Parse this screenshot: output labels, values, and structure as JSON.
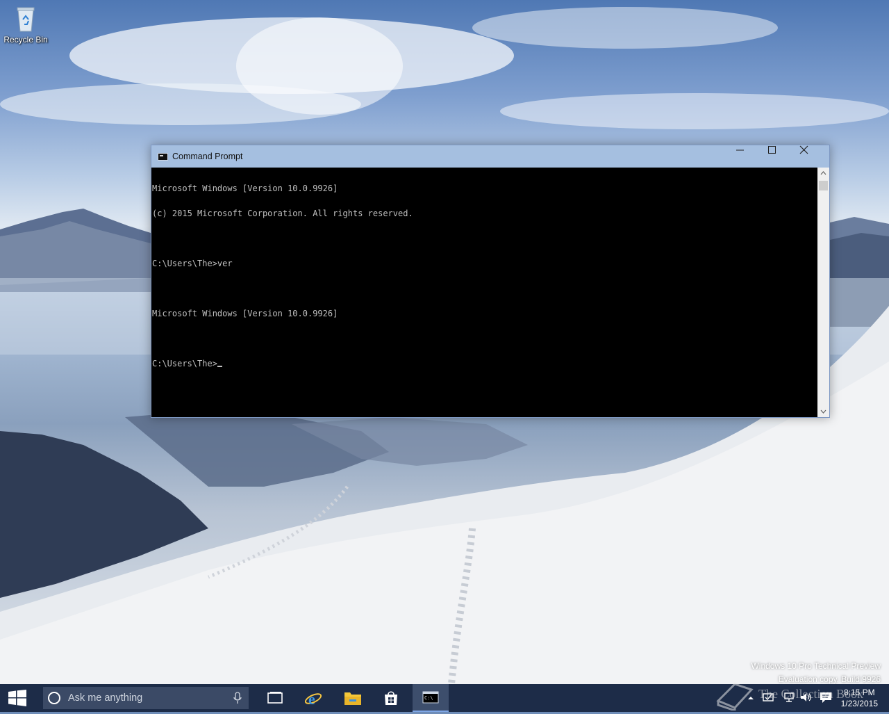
{
  "desktop": {
    "icons": [
      {
        "label": "Recycle Bin",
        "icon": "recycle-bin-icon"
      }
    ]
  },
  "window": {
    "title": "Command Prompt",
    "icon": "command-prompt-icon",
    "controls": {
      "minimize": "minimize-icon",
      "maximize": "maximize-icon",
      "close": "close-icon"
    },
    "console_lines": [
      "Microsoft Windows [Version 10.0.9926]",
      "(c) 2015 Microsoft Corporation. All rights reserved.",
      "",
      "C:\\Users\\The>ver",
      "",
      "Microsoft Windows [Version 10.0.9926]",
      "",
      "C:\\Users\\The>"
    ]
  },
  "watermark": {
    "line1": "Windows 10 Pro Technical Preview",
    "line2": "Evaluation copy. Build 9926",
    "logo_text": "The Collection Book"
  },
  "taskbar": {
    "search_placeholder": "Ask me anything",
    "apps": [
      {
        "name": "Task View",
        "icon": "task-view-icon"
      },
      {
        "name": "Internet Explorer",
        "icon": "internet-explorer-icon"
      },
      {
        "name": "File Explorer",
        "icon": "folder-icon"
      },
      {
        "name": "Store",
        "icon": "store-icon"
      },
      {
        "name": "Command Prompt",
        "icon": "command-prompt-icon",
        "active": true
      }
    ],
    "clock": {
      "time": "8:15 PM",
      "date": "1/23/2015"
    }
  },
  "colors": {
    "taskbar": "#1d2c48",
    "titlebar": "#a5bfe0",
    "console_bg": "#000000",
    "console_text": "#c0c0c0"
  }
}
